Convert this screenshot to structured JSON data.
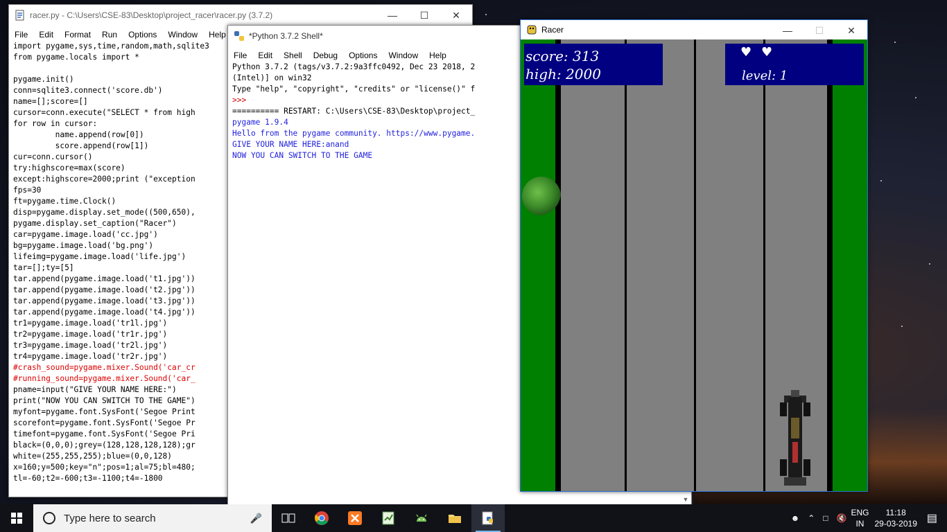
{
  "editor": {
    "title": "racer.py - C:\\Users\\CSE-83\\Desktop\\project_racer\\racer.py (3.7.2)",
    "menu": [
      "File",
      "Edit",
      "Format",
      "Run",
      "Options",
      "Window",
      "Help"
    ],
    "lines": [
      "import pygame,sys,time,random,math,sqlite3",
      "from pygame.locals import *",
      "",
      "pygame.init()",
      "conn=sqlite3.connect('score.db')",
      "name=[];score=[]",
      "cursor=conn.execute(\"SELECT * from high",
      "for row in cursor:",
      "         name.append(row[0])",
      "         score.append(row[1])",
      "cur=conn.cursor()",
      "try:highscore=max(score)",
      "except:highscore=2000;print (\"exception",
      "fps=30",
      "ft=pygame.time.Clock()",
      "disp=pygame.display.set_mode((500,650),",
      "pygame.display.set_caption(\"Racer\")",
      "car=pygame.image.load('cc.jpg')",
      "bg=pygame.image.load('bg.png')",
      "lifeimg=pygame.image.load('life.jpg')",
      "tar=[];ty=[5]",
      "tar.append(pygame.image.load('t1.jpg'))",
      "tar.append(pygame.image.load('t2.jpg'))",
      "tar.append(pygame.image.load('t3.jpg'))",
      "tar.append(pygame.image.load('t4.jpg'))",
      "tr1=pygame.image.load('tr1l.jpg')",
      "tr2=pygame.image.load('tr1r.jpg')",
      "tr3=pygame.image.load('tr2l.jpg')",
      "tr4=pygame.image.load('tr2r.jpg')",
      "#crash_sound=pygame.mixer.Sound('car_cr",
      "#running_sound=pygame.mixer.Sound('car_",
      "pname=input(\"GIVE YOUR NAME HERE:\")",
      "print(\"NOW YOU CAN SWITCH TO THE GAME\")",
      "myfont=pygame.font.SysFont('Segoe Print",
      "scorefont=pygame.font.SysFont('Segoe Pr",
      "timefont=pygame.font.SysFont('Segoe Pri",
      "black=(0,0,0);grey=(128,128,128,128);gr",
      "white=(255,255,255);blue=(0,0,128)",
      "x=160;y=500;key=\"n\";pos=1;al=75;bl=480;",
      "tl=-60;t2=-600;t3=-1100;t4=-1800"
    ]
  },
  "shell": {
    "title": "*Python 3.7.2 Shell*",
    "menu": [
      "File",
      "Edit",
      "Shell",
      "Debug",
      "Options",
      "Window",
      "Help"
    ],
    "lines": [
      "Python 3.7.2 (tags/v3.7.2:9a3ffc0492, Dec 23 2018, 2",
      "(Intel)] on win32",
      "Type \"help\", \"copyright\", \"credits\" or \"license()\" f",
      ">>> ",
      "========== RESTART: C:\\Users\\CSE-83\\Desktop\\project_",
      "pygame 1.9.4",
      "Hello from the pygame community. https://www.pygame.",
      "GIVE YOUR NAME HERE:anand",
      "NOW YOU CAN SWITCH TO THE GAME"
    ]
  },
  "racer": {
    "title": "Racer",
    "score_label": "score: 313",
    "high_label": "high:  2000",
    "level_label": "level:  1",
    "lives": 2
  },
  "taskbar": {
    "search_placeholder": "Type here to search",
    "icons": [
      "task-view-icon",
      "chrome-icon",
      "xampp-icon",
      "notepad-icon",
      "android-studio-icon",
      "file-explorer-icon",
      "python-icon"
    ],
    "lang_top": "ENG",
    "lang_bottom": "IN",
    "time": "11:18",
    "date": "29-03-2019"
  },
  "colors": {
    "game_blue_panel": "#000080",
    "grass": "#008000",
    "road": "#808080",
    "taskbar": "#101218"
  }
}
